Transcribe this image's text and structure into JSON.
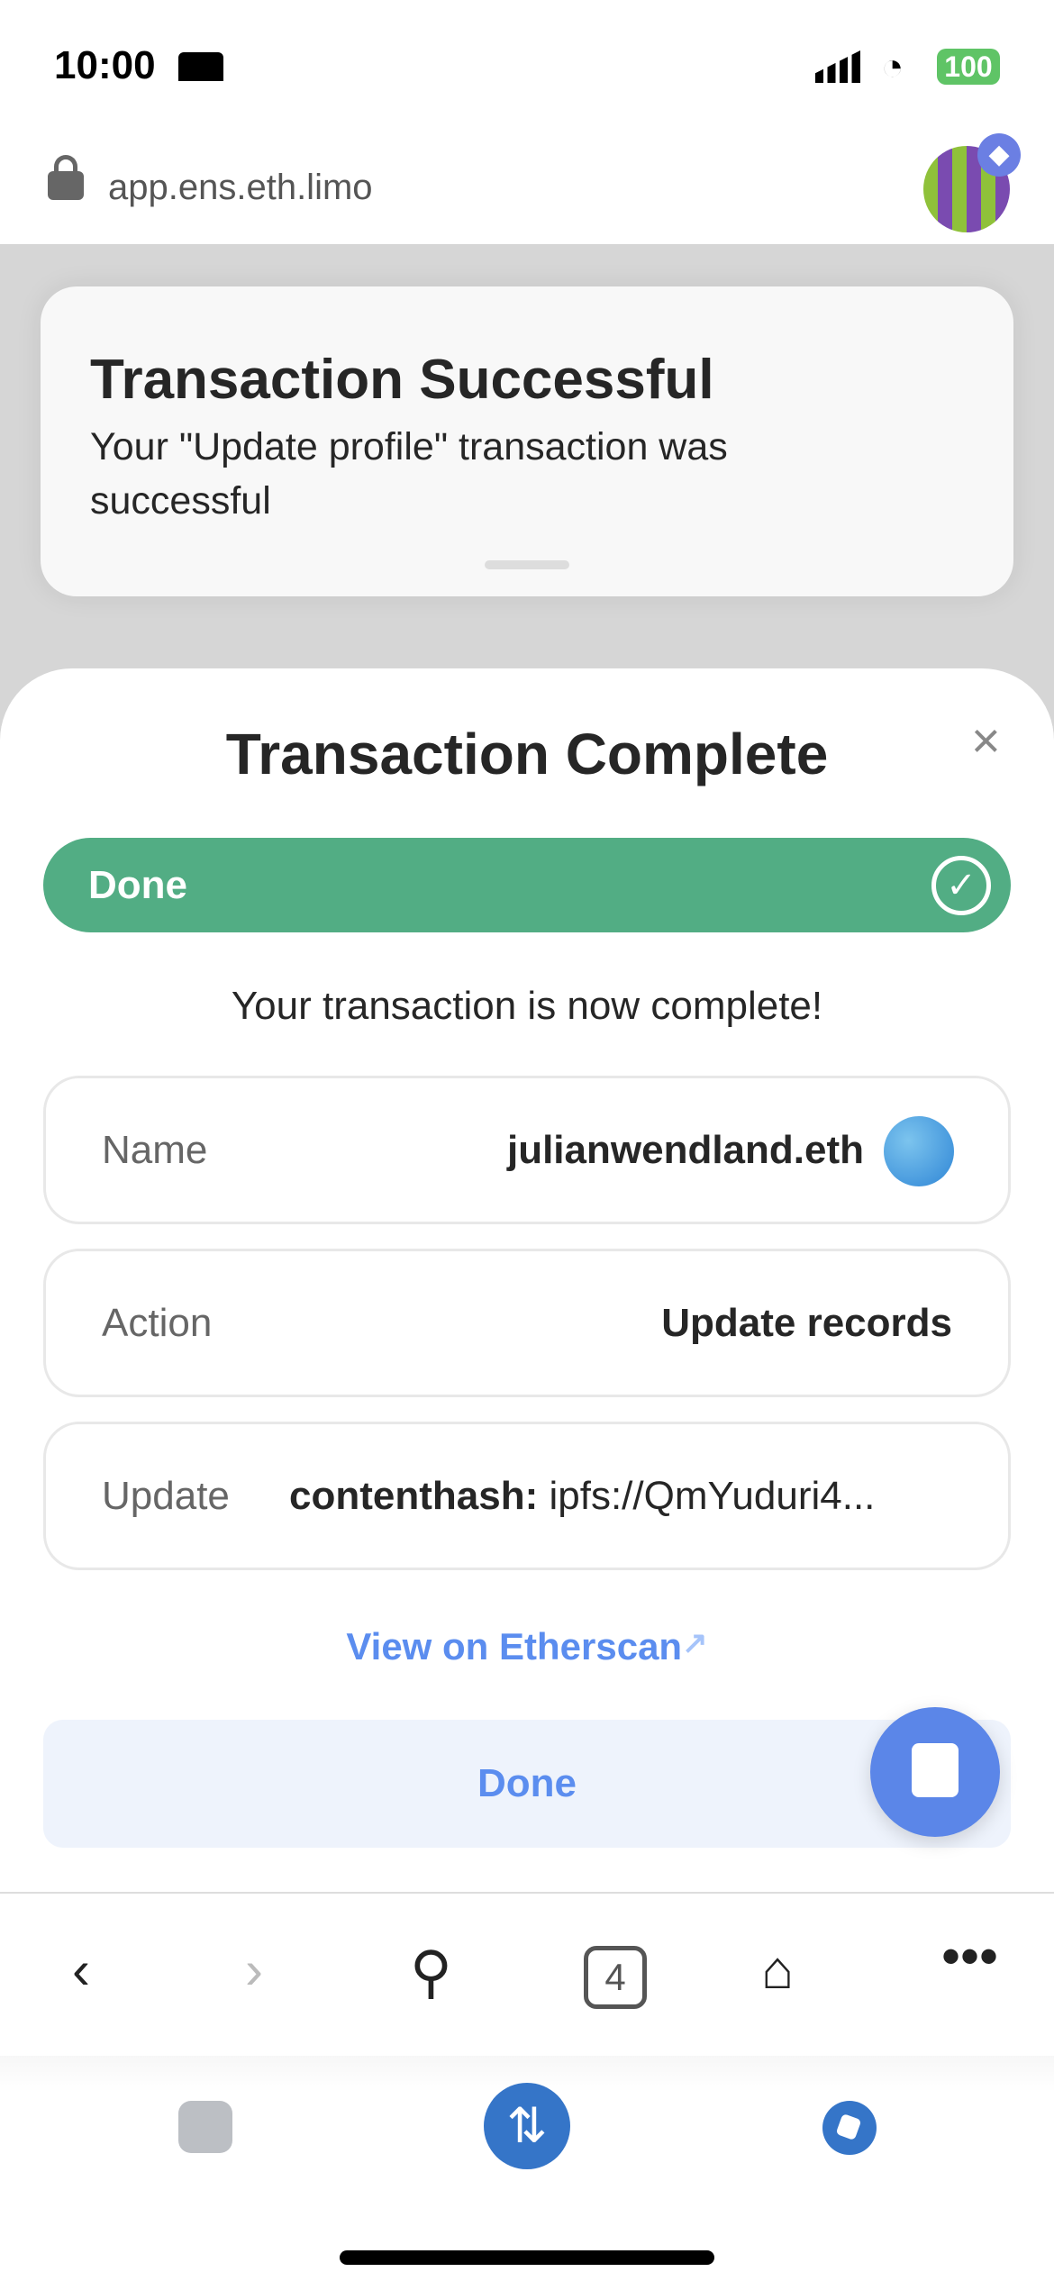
{
  "status_bar": {
    "time": "10:00",
    "battery": "100"
  },
  "browser": {
    "url": "app.ens.eth.limo",
    "tabs_count": "4"
  },
  "toast": {
    "title": "Transaction Successful",
    "message": "Your \"Update profile\" transaction was successful"
  },
  "sheet": {
    "title": "Transaction Complete",
    "progress_label": "Done",
    "complete_message": "Your transaction is now complete!",
    "rows": [
      {
        "label": "Name",
        "value": "julianwendland.eth"
      },
      {
        "label": "Action",
        "value": "Update records"
      },
      {
        "label": "Update",
        "key": "contenthash:",
        "value": "ipfs://QmYuduri4..."
      }
    ],
    "etherscan_link": "View on Etherscan",
    "done_button": "Done"
  },
  "colors": {
    "success": "#52ad84",
    "accent": "#5b8def",
    "nav_blue": "#3575c8"
  }
}
